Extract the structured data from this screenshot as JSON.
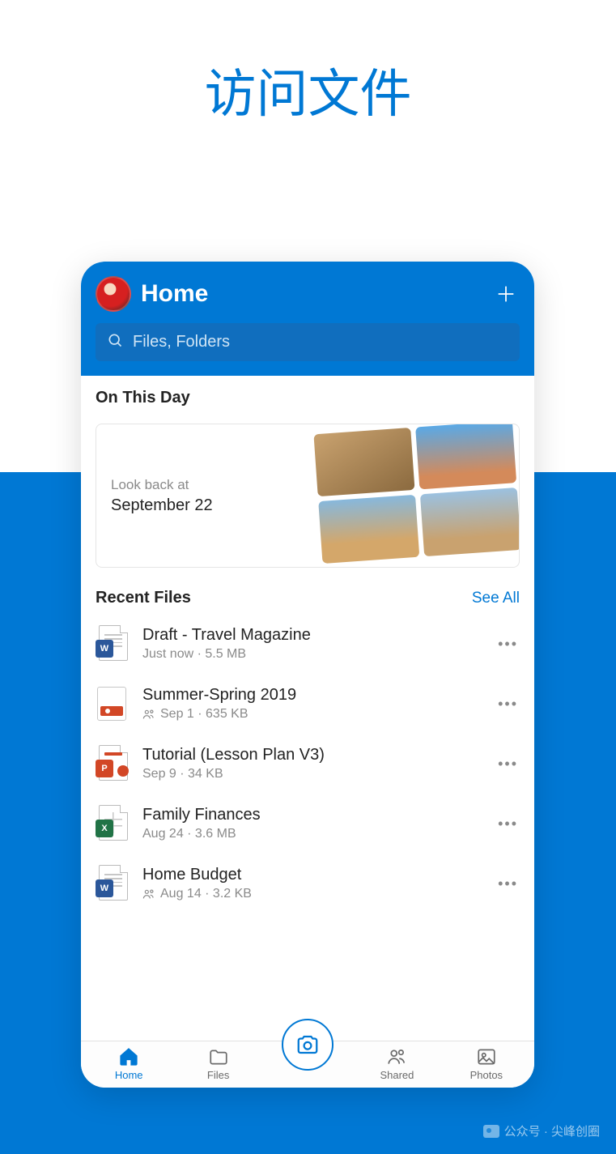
{
  "hero": {
    "title": "访问文件"
  },
  "header": {
    "title": "Home",
    "search_placeholder": "Files, Folders"
  },
  "memory": {
    "section_title": "On This Day",
    "caption": "Look back at",
    "date": "September 22"
  },
  "recent": {
    "title": "Recent Files",
    "see_all": "See All",
    "files": [
      {
        "name": "Draft - Travel Magazine",
        "meta": "Just now · 5.5 MB",
        "type": "word",
        "shared": false
      },
      {
        "name": "Summer-Spring 2019",
        "meta": "Sep 1 · 635 KB",
        "type": "onenote",
        "shared": true
      },
      {
        "name": "Tutorial (Lesson Plan V3)",
        "meta": "Sep 9 · 34 KB",
        "type": "ppt",
        "shared": false
      },
      {
        "name": "Family Finances",
        "meta": "Aug 24 · 3.6 MB",
        "type": "xls",
        "shared": false
      },
      {
        "name": "Home Budget",
        "meta": "Aug 14 · 3.2 KB",
        "type": "word",
        "shared": true
      }
    ]
  },
  "tabs": {
    "home": "Home",
    "files": "Files",
    "shared": "Shared",
    "photos": "Photos"
  },
  "watermark": {
    "text": "公众号 · 尖峰创圈"
  }
}
